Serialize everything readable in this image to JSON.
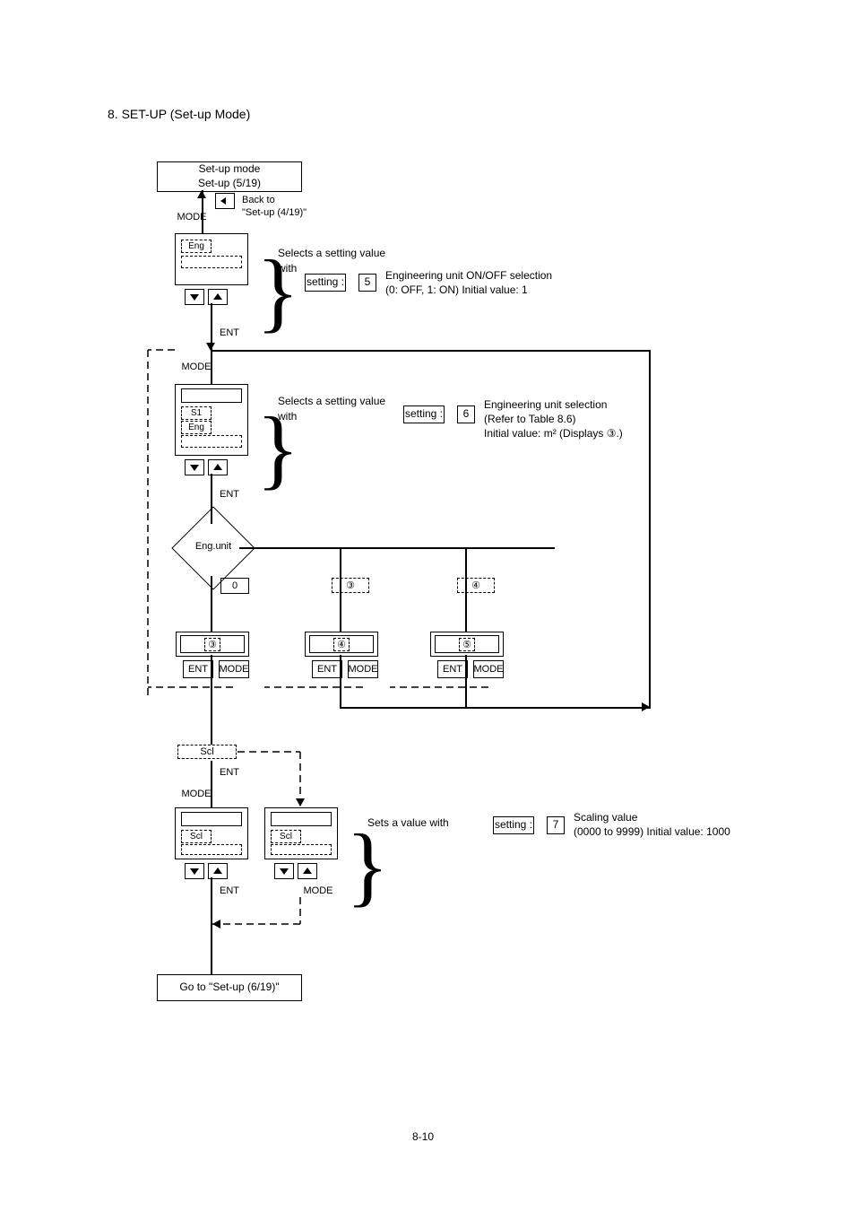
{
  "title": "8. SET-UP (Set-up Mode)",
  "top_box_line1": "Set-up mode",
  "top_box_line2": "Set-up (5/19)",
  "top_key_mode_left": "MODE",
  "top_key_back": "Back to",
  "top_key_back2": "\"Set-up (4/19)\"",
  "panel1_opt": "Eng",
  "panel1_line1": "Selects a setting value",
  "panel1_line2": "with",
  "panel1_setting_label": "setting :",
  "panel1_setting_index": "5",
  "panel1_detail1": "Engineering unit ON/OFF selection",
  "panel1_detail2": "(0: OFF, 1: ON) Initial value: 1",
  "panel1_ent": "ENT",
  "panel1_mode": "MODE",
  "panel2_frame": "S",
  "panel2_opt1": "S1",
  "panel2_opt2": "Eng",
  "panel2_line1": "Selects a setting value",
  "panel2_line2": "with",
  "panel2_setting_label": "setting :",
  "panel2_setting_index": "6",
  "panel2_detail1": "Engineering unit selection",
  "panel2_detail2": "(Refer to Table 8.6)",
  "panel2_detail3": "Initial value: m² (Displays ③.)",
  "panel2_ent": "ENT",
  "panel2_mode": "MODE",
  "diamond_label": "Eng.unit",
  "branch1": "0",
  "branch2": "③",
  "branch3": "④",
  "disp1": "③",
  "disp1_ent": "ENT",
  "disp1_mode": "MODE",
  "disp2": "④",
  "disp2_ent": "ENT",
  "disp2_mode": "MODE",
  "disp3": "⑤",
  "disp3_ent": "ENT",
  "disp3_mode": "MODE",
  "scl": "Scl",
  "scl_mode": "MODE",
  "scl_ent": "ENT",
  "lcd3a_frame": "S",
  "lcd3a_opt1": "Scl",
  "lcd3a_ent": "ENT",
  "lcd3b_frame": "S",
  "lcd3b_opt1": "Scl",
  "lcd3b_mode": "MODE",
  "panel3_line1": "Sets a value with",
  "panel3_setting_label": "setting :",
  "panel3_setting_index": "7",
  "panel3_detail1": "Scaling value",
  "panel3_detail2": "(0000 to 9999) Initial value: 1000",
  "bottom_box": "Go to \"Set-up (6/19)\"",
  "page_num": "8-10"
}
